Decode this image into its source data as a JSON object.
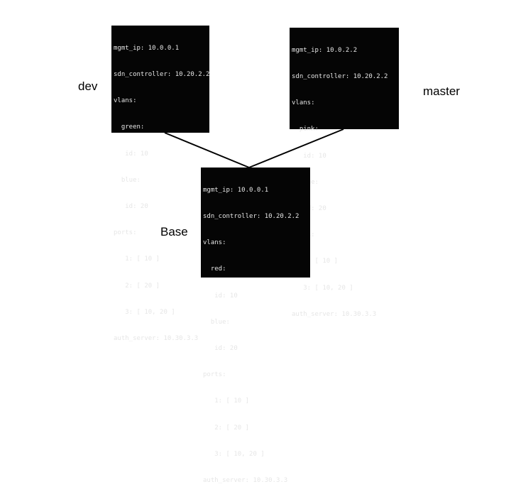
{
  "labels": {
    "dev": "dev",
    "master": "master",
    "base": "Base"
  },
  "configs": {
    "dev": [
      "mgmt_ip: 10.0.0.1",
      "sdn_controller: 10.20.2.2",
      "vlans:",
      "  green:",
      "   id: 10",
      "  blue:",
      "   id: 20",
      "ports:",
      "   1: [ 10 ]",
      "   2: [ 20 ]",
      "   3: [ 10, 20 ]",
      "auth_server: 10.30.3.3"
    ],
    "master": [
      "mgmt_ip: 10.0.2.2",
      "sdn_controller: 10.20.2.2",
      "vlans:",
      "  pink:",
      "   id: 10",
      "  blue:",
      "   id: 20",
      "ports:",
      "   1: [ 10 ]",
      "   3: [ 10, 20 ]",
      "auth_server: 10.30.3.3"
    ],
    "base": [
      "mgmt_ip: 10.0.0.1",
      "sdn_controller: 10.20.2.2",
      "vlans:",
      "  red:",
      "   id: 10",
      "  blue:",
      "   id: 20",
      "ports:",
      "   1: [ 10 ]",
      "   2: [ 20 ]",
      "   3: [ 10, 20 ]",
      "auth_server: 10.30.3.3"
    ]
  },
  "colors": {
    "terminal_background": "#050505",
    "terminal_text": "#e6e6e6",
    "connector": "#000000"
  }
}
